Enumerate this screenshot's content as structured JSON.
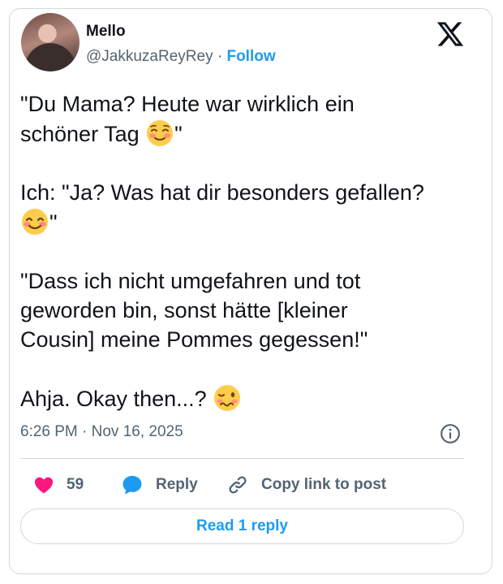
{
  "author": {
    "name": "Mello",
    "handle": "@JakkuzaReyRey",
    "separator": "·",
    "follow_label": "Follow"
  },
  "tweet": {
    "paragraphs": [
      {
        "lines": [
          "\"Du Mama? Heute war wirklich ein",
          "schöner Tag "
        ],
        "trail": "\"",
        "emoji": "smiling-face-icon"
      },
      {
        "lines": [
          "Ich: \"Ja? Was hat dir besonders gefallen?"
        ],
        "trail": "\"",
        "emoji": "blushing-face-icon"
      },
      {
        "lines": [
          "\"Dass ich nicht umgefahren und tot",
          "geworden bin, sonst hätte [kleiner",
          "Cousin] meine Pommes gegessen!\""
        ]
      },
      {
        "lines": [
          "Ahja. Okay then...? "
        ],
        "emoji": "woozy-face-icon"
      }
    ],
    "timestamp": "6:26 PM · Nov 16, 2025"
  },
  "actions": {
    "likes": "59",
    "reply_label": "Reply",
    "copy_label": "Copy link to post"
  },
  "replies_button": "Read 1 reply",
  "colors": {
    "accent": "#1d9bf0",
    "like": "#f91880",
    "text": "#0f1419",
    "muted": "#536471",
    "border": "#cfd9de"
  }
}
